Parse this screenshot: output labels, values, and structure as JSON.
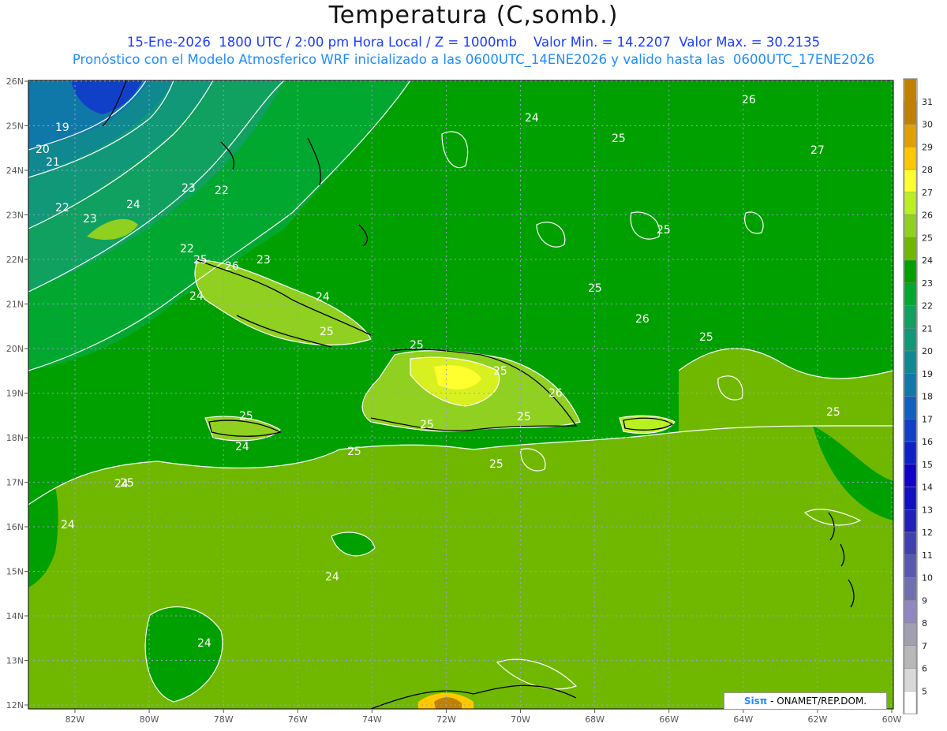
{
  "header": {
    "title": "Temperatura (C,somb.)",
    "line1": "15-Ene-2026  1800 UTC / 2:00 pm Hora Local / Z = 1000mb    Valor Min. = 14.2207  Valor Max. = 30.2135",
    "line2": "Pronóstico con el Modelo Atmosferico WRF inicializado a las 0600UTC_14ENE2026 y valido hasta las  0600UTC_17ENE2026"
  },
  "map": {
    "lat_labels": [
      "26N",
      "25N",
      "24N",
      "23N",
      "22N",
      "21N",
      "20N",
      "19N",
      "18N",
      "17N",
      "16N",
      "15N",
      "14N",
      "13N",
      "12N"
    ],
    "lon_labels": [
      "82W",
      "80W",
      "78W",
      "76W",
      "74W",
      "72W",
      "70W",
      "68W",
      "66W",
      "64W",
      "62W",
      "60W"
    ],
    "contour_labels": [
      {
        "text": "19"
      },
      {
        "text": "20"
      },
      {
        "text": "21"
      },
      {
        "text": "22"
      },
      {
        "text": "23"
      },
      {
        "text": "24"
      },
      {
        "text": "23"
      },
      {
        "text": "22"
      },
      {
        "text": "22"
      },
      {
        "text": "24"
      },
      {
        "text": "25"
      },
      {
        "text": "26"
      },
      {
        "text": "23"
      },
      {
        "text": "24"
      },
      {
        "text": "24"
      },
      {
        "text": "25"
      },
      {
        "text": "26"
      },
      {
        "text": "27"
      },
      {
        "text": "25"
      },
      {
        "text": "26"
      },
      {
        "text": "25"
      },
      {
        "text": "25"
      },
      {
        "text": "26"
      },
      {
        "text": "25"
      },
      {
        "text": "25"
      },
      {
        "text": "25"
      },
      {
        "text": "25"
      },
      {
        "text": "24"
      },
      {
        "text": "24"
      },
      {
        "text": "24"
      },
      {
        "text": "24"
      },
      {
        "text": "24"
      },
      {
        "text": "25"
      },
      {
        "text": "25"
      },
      {
        "text": "25"
      },
      {
        "text": "25"
      },
      {
        "text": "25"
      },
      {
        "text": "25"
      }
    ]
  },
  "colorbar": {
    "labels": [
      "31",
      "30",
      "29",
      "28",
      "27",
      "26",
      "25",
      "24",
      "23",
      "22",
      "21",
      "20",
      "19",
      "18",
      "17",
      "16",
      "15",
      "14",
      "13",
      "12",
      "11",
      "10",
      "9",
      "8",
      "7",
      "6",
      "5"
    ],
    "colors": [
      "#c08000",
      "#e0a000",
      "#ffc800",
      "#ffff30",
      "#b8f020",
      "#90d020",
      "#70b800",
      "#00a000",
      "#00a830",
      "#10a060",
      "#109878",
      "#108890",
      "#1078a8",
      "#1060c0",
      "#1040c8",
      "#1020c8",
      "#1000c8",
      "#1010c0",
      "#2020b8",
      "#4040b0",
      "#5858b0",
      "#7070b0",
      "#9088c0",
      "#a0a0b0",
      "#b8b8b8",
      "#d8d8d8",
      "#ffffff"
    ]
  },
  "credit": {
    "brand": "Sisπ",
    "text": " - ONAMET/REP.DOM."
  }
}
